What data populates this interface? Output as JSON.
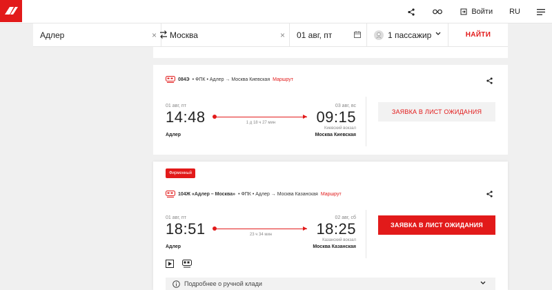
{
  "header": {
    "login_label": "Войти",
    "lang_label": "RU",
    "icons": [
      "logo-icon",
      "share-icon",
      "glasses-icon",
      "login-icon",
      "menu-icon"
    ]
  },
  "search": {
    "from": "Адлер",
    "to": "Москва",
    "date": "01 авг, пт",
    "passengers": "1 пассажир",
    "find_label": "НАЙТИ"
  },
  "trains": [
    {
      "number": "084Э",
      "carrier": "• ФПК • Адлер → Москва Киевская",
      "route_link": "Маршрут",
      "dep_date": "01 авг, пт",
      "dep_time": "14:48",
      "arr_date": "03 авг, вс",
      "arr_time": "09:15",
      "duration": "1 д 18 ч 27 мин",
      "arr_terminal": "Киевский вокзал",
      "dep_station": "Адлер",
      "arr_station": "Москва Киевская",
      "button": "ЗАЯВКА В ЛИСТ ОЖИДАНИЯ"
    },
    {
      "badge": "Фирменный",
      "number": "104Ж «Адлер – Москва»",
      "carrier": "• ФПК • Адлер → Москва Казанская",
      "route_link": "Маршрут",
      "dep_date": "01 авг, пт",
      "dep_time": "18:51",
      "arr_date": "02 авг, сб",
      "arr_time": "18:25",
      "duration": "23 ч 34 мин",
      "arr_terminal": "Казанский вокзал",
      "dep_station": "Адлер",
      "arr_station": "Москва Казанская",
      "button": "ЗАЯВКА В ЛИСТ ОЖИДАНИЯ",
      "luggage_label": "Подробнее о ручной клади"
    }
  ],
  "colors": {
    "accent": "#e21a1a",
    "background": "#f0f0f0"
  }
}
